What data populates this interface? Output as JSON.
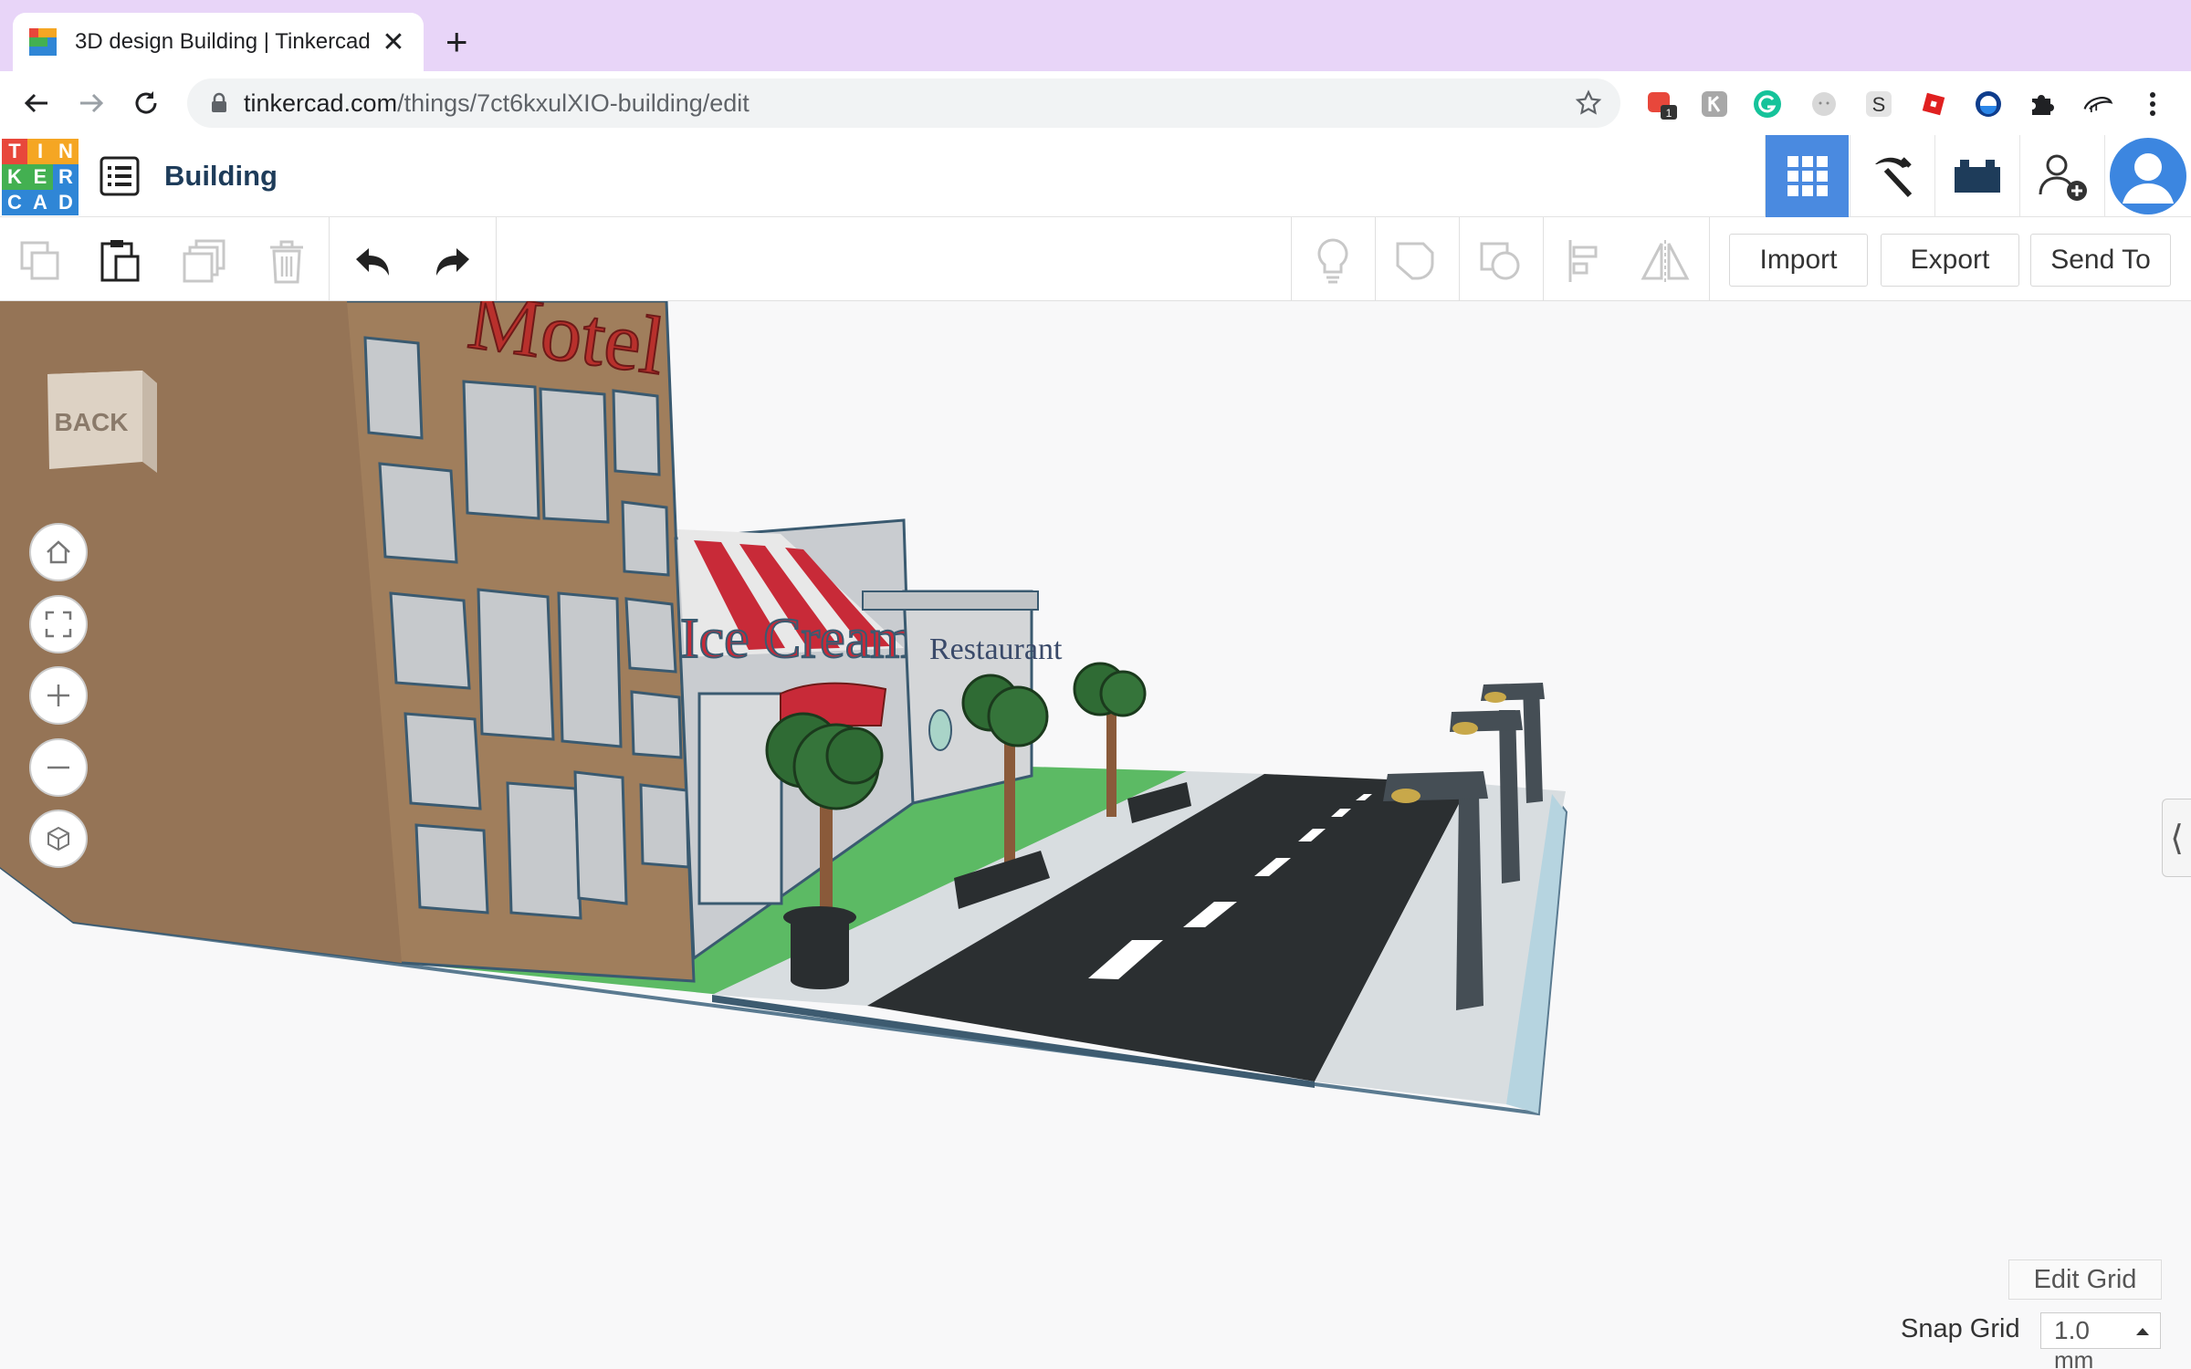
{
  "browser": {
    "tab_title": "3D design Building | Tinkercad",
    "url_host": "tinkercad.com",
    "url_path": "/things/7ct6kxulXIO-building/edit",
    "extension_badge": "1"
  },
  "app": {
    "logo_letters": [
      "T",
      "I",
      "N",
      "K",
      "E",
      "R",
      "C",
      "A",
      "D"
    ],
    "logo_colors": [
      "#e8473b",
      "#f5a623",
      "#f5a623",
      "#43b051",
      "#43b051",
      "#2f86d6",
      "#2f86d6",
      "#2f86d6",
      "#2f86d6"
    ],
    "project_name": "Building",
    "accent": "#4a8ae0"
  },
  "toolbar": {
    "icons": [
      "copy-icon",
      "paste-icon",
      "duplicate-icon",
      "delete-icon",
      "undo-icon",
      "redo-icon",
      "note-icon",
      "group-icon",
      "ungroup-icon",
      "align-icon",
      "mirror-icon"
    ],
    "import_label": "Import",
    "export_label": "Export",
    "send_to_label": "Send To"
  },
  "workplane": {
    "viewcube_face": "BACK",
    "view_controls": [
      "home-view",
      "fit-all",
      "zoom-in",
      "zoom-out",
      "orthographic"
    ],
    "scene_signs": [
      "Motel",
      "Ice Cream"
    ],
    "edit_grid_label": "Edit Grid",
    "snap_grid_label": "Snap Grid",
    "snap_value": "1.0",
    "snap_unit": "mm"
  }
}
